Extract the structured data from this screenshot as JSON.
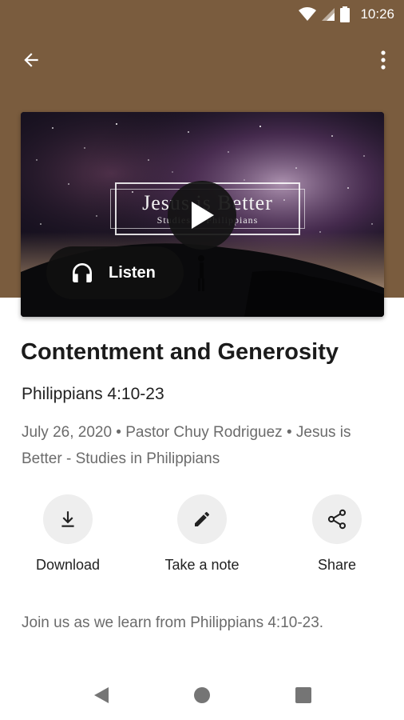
{
  "status_bar": {
    "time": "10:26",
    "icons": [
      "wifi-icon",
      "signal-icon",
      "battery-icon"
    ]
  },
  "app_bar": {
    "back_icon": "arrow-back-icon",
    "more_icon": "more-vert-icon"
  },
  "artwork": {
    "title_text": "Jesus is Better",
    "subtitle_text": "Studies in Philippians",
    "play_icon": "play-icon",
    "listen_label": "Listen",
    "listen_icon": "headphones-icon"
  },
  "sermon": {
    "title": "Contentment and Generosity",
    "scripture": "Philippians 4:10-23",
    "meta": "July 26, 2020 • Pastor Chuy Rodriguez • Jesus is Better - Studies in Philippians",
    "description": "Join us as we learn from Philippians 4:10-23."
  },
  "actions": [
    {
      "label": "Download",
      "icon": "download-icon"
    },
    {
      "label": "Take a note",
      "icon": "pencil-icon"
    },
    {
      "label": "Share",
      "icon": "share-icon"
    }
  ],
  "nav_bar": {
    "icons": [
      "nav-back-icon",
      "nav-home-icon",
      "nav-recents-icon"
    ]
  },
  "colors": {
    "header_brown": "#7a5c3e",
    "action_circle": "#eeeeee",
    "meta_text": "#6b6b6b"
  }
}
